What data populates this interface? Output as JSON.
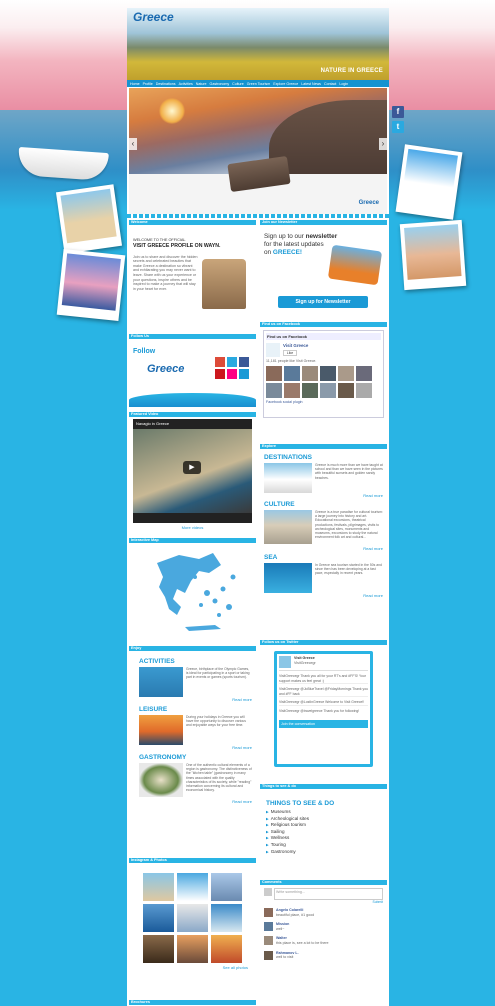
{
  "site": {
    "logo_text": "Greece",
    "tagline": "NATURE IN GREECE"
  },
  "nav": [
    "Home",
    "Profile",
    "Destinations",
    "Activities",
    "Nature",
    "Gastronomy",
    "Culture",
    "Green Tourism",
    "Explore Greece",
    "Latest News",
    "Contact",
    "Login"
  ],
  "slider": {
    "logo_text": "Greece",
    "prev": "‹",
    "next": "›"
  },
  "share": {
    "facebook": "f",
    "twitter": "t"
  },
  "welcome": {
    "bar": "Welcome",
    "pre": "WELCOME TO THE OFFICIAL",
    "headline": "VISIT GREECE PROFILE ON WAYN.",
    "body": "Join us to share and discover the hidden secrets and celebrated beauties that make Greece a destination so vibrant and exhilarating you may never want to leave. Share with us your experience or your questions, inspire others and be inspired to make a journey that will stay in your heart for ever."
  },
  "newsletter": {
    "bar": "Join our Newsletter",
    "line1": "Sign up to our",
    "line1_bold": "newsletter",
    "line2": "for the latest updates",
    "line3": "on",
    "line3_accent": "GREECE!",
    "button": "Sign up for Newsletter"
  },
  "follow": {
    "bar": "Follow Us",
    "label": "Follow",
    "logo_text": "Greece"
  },
  "facebook": {
    "bar": "Find us on Facebook",
    "header": "Find us on Facebook",
    "page": "Visit Greece",
    "like": "Like",
    "count": "11,181 people like Visit Greece.",
    "plugin": "Facebook social plugin"
  },
  "video": {
    "bar": "Featured Video",
    "title": "Navagio in Greece",
    "more": "More videos"
  },
  "map": {
    "bar": "Interactive Map"
  },
  "explore": {
    "bar": "Explore",
    "items": [
      {
        "title": "DESTINATIONS",
        "text": "Greece is much more than we have taught at school and than we have seen in the pictures with beautiful sunsets and golden sandy beaches.",
        "more": "Read more"
      },
      {
        "title": "CULTURE",
        "text": "Greece is a true paradise for cultural tourism: a large journey into history and art. Educational excursions, theatrical productions, festivals, pilgrimages, visits to archeological sites, monuments and museums, excursions to study the natural environment folk art and cultural...",
        "more": "Read more"
      },
      {
        "title": "SEA",
        "text": "In Greece sea tourism started in the 50s and since then has been developing at a fast pace, especially in recent years.",
        "more": "Read more"
      }
    ]
  },
  "enjoy": {
    "bar": "Enjoy",
    "items": [
      {
        "title": "ACTIVITIES",
        "text": "Greece, birthplace of the Olympic Games, is ideal for participating in a sport or taking part in events or games (sports tourism).",
        "more": "Read more"
      },
      {
        "title": "LEISURE",
        "text": "During your holidays in Greece you will have the opportunity to discover various and enjoyable ways for your free time.",
        "more": "Read more"
      },
      {
        "title": "GASTRONOMY",
        "text": "One of the authentic cultural elements of a region is gastronomy. The distinctiveness of the \"kitchen table\" (gastronomy in many times associated with the quality characteristics of its society, while \"reading\" information concerning its cultural and economical history.",
        "more": "Read more"
      }
    ]
  },
  "twitter": {
    "bar": "Follow us on Twitter",
    "account": "Visit Greece",
    "handle": "VisitGreecegr",
    "tweets": [
      "VisitGreecegr Thank you all for your RT's and #FF'S! Your support makes us feel great :)",
      "VisitGreecegr @JoBlueTravel @FridayMornings Thank you and #FF back",
      "VisitGreecegr @LostInGreece Welcome to Visit Greece!!",
      "VisitGreecegr @travelgreece Thank you for following!"
    ],
    "footer": "Join the conversation"
  },
  "things": {
    "bar": "Things to see & do",
    "title": "THINGS TO SEE & DO",
    "items": [
      "Museums",
      "Archeological sites",
      "Religious tourism",
      "Sailing",
      "Wellness",
      "Touring",
      "Gastronomy"
    ]
  },
  "instagram": {
    "bar": "Instagram & Photos",
    "more": "See all photos"
  },
  "comments": {
    "bar": "Comments",
    "placeholder": "Write something...",
    "submit": "Submit",
    "items": [
      {
        "name": "Angelo Colarelli",
        "text": "beautiful place, #1 good"
      },
      {
        "name": "Mission",
        "text": "well~"
      },
      {
        "name": "Walter",
        "text": "this place is, see a lot to be there"
      },
      {
        "name": "Rahmanov L.",
        "text": "well to visit"
      }
    ]
  },
  "brochure": {
    "bar": "Brochures"
  },
  "colors": {
    "accent": "#29b4e4",
    "link": "#1a9ad6",
    "nav": "#1593d0"
  }
}
